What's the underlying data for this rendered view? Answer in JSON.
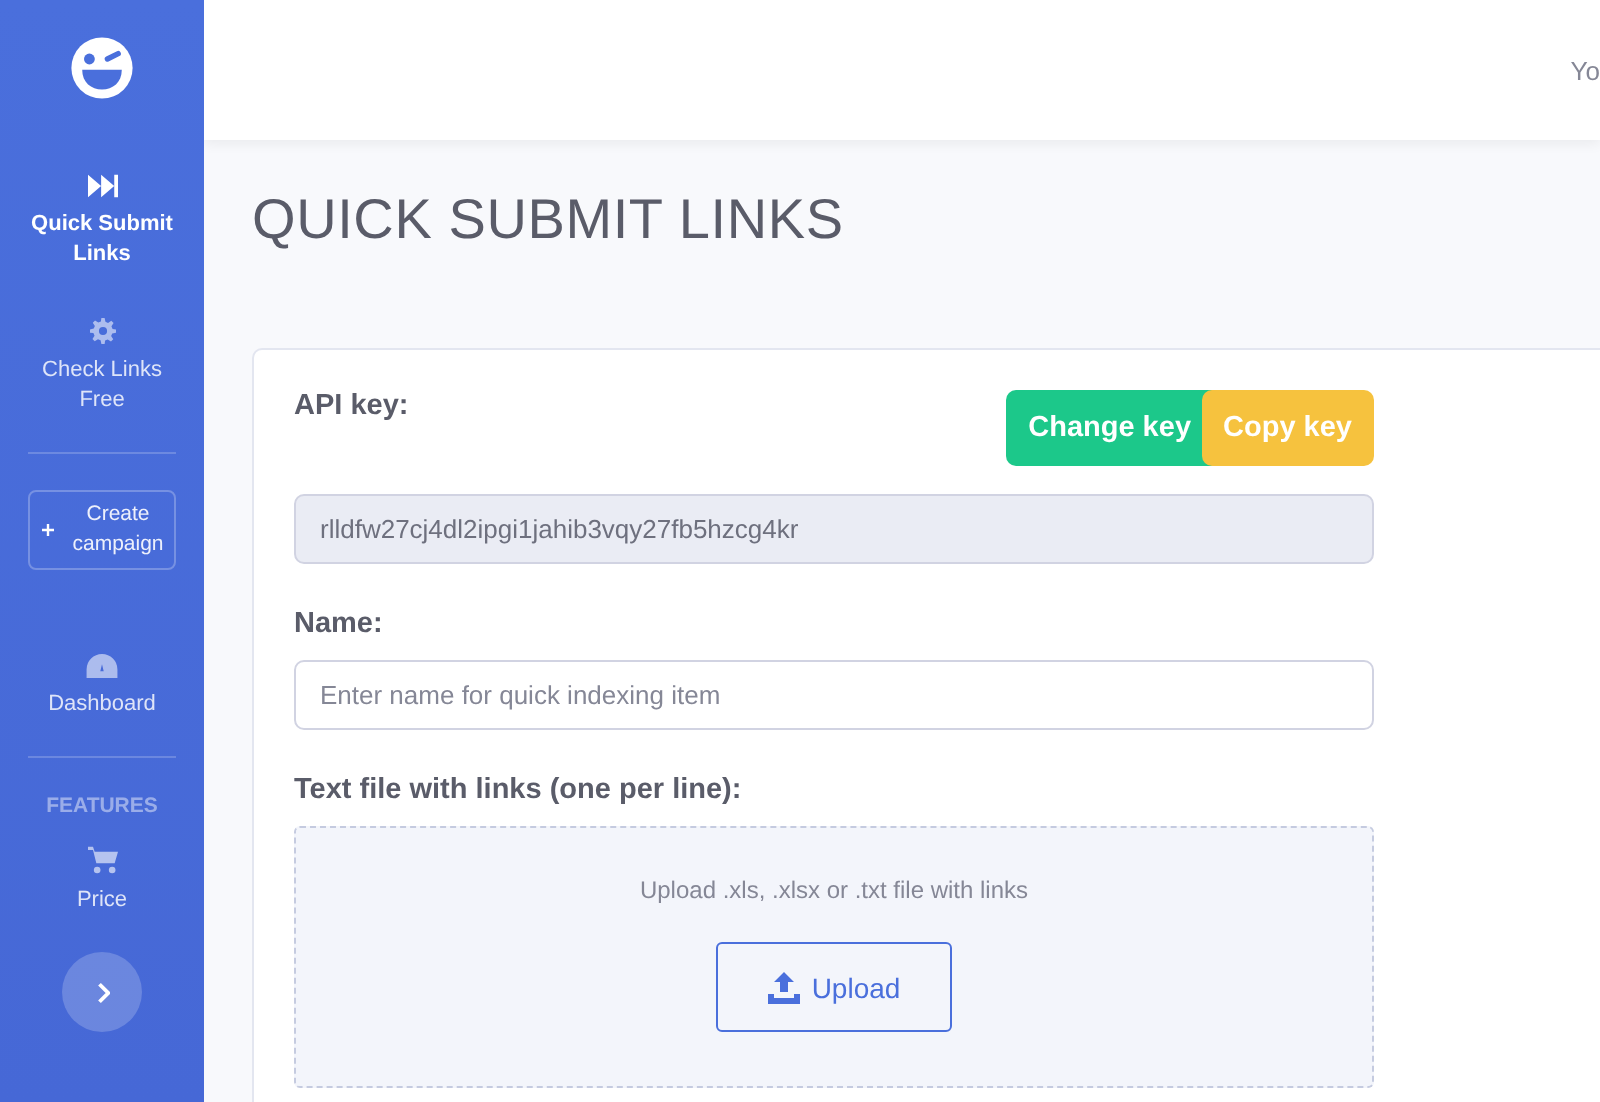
{
  "sidebar": {
    "entries": [
      {
        "kind": "link",
        "label": "Quick Submit Links",
        "selected": true
      },
      {
        "kind": "link",
        "label": "Check Links Free",
        "selected": false
      },
      {
        "kind": "divider"
      },
      {
        "kind": "button",
        "label": "Create campaign"
      },
      {
        "kind": "link",
        "label": "Dashboard",
        "selected": false
      },
      {
        "kind": "divider"
      },
      {
        "kind": "heading",
        "label": "FEATURES"
      },
      {
        "kind": "link",
        "label": "Price",
        "selected": false
      },
      {
        "kind": "toggle"
      }
    ]
  },
  "topbar": {
    "user_text": "Yo"
  },
  "page_title": "QUICK SUBMIT LINKS",
  "form": {
    "api_key": {
      "label": "API key:",
      "value": "rlldfw27cj4dl2ipgi1jahib3vqy27fb5hzcg4kr",
      "buttons": [
        {
          "label": "Change key",
          "kind": "success"
        },
        {
          "label": "Copy key",
          "kind": "warning"
        }
      ]
    },
    "name": {
      "label": "Name:",
      "placeholder": "Enter name for quick indexing item"
    },
    "file": {
      "label": "Text file with links (one per line):",
      "hint": "Upload .xls, .xlsx or .txt file with links",
      "button": "Upload"
    }
  }
}
